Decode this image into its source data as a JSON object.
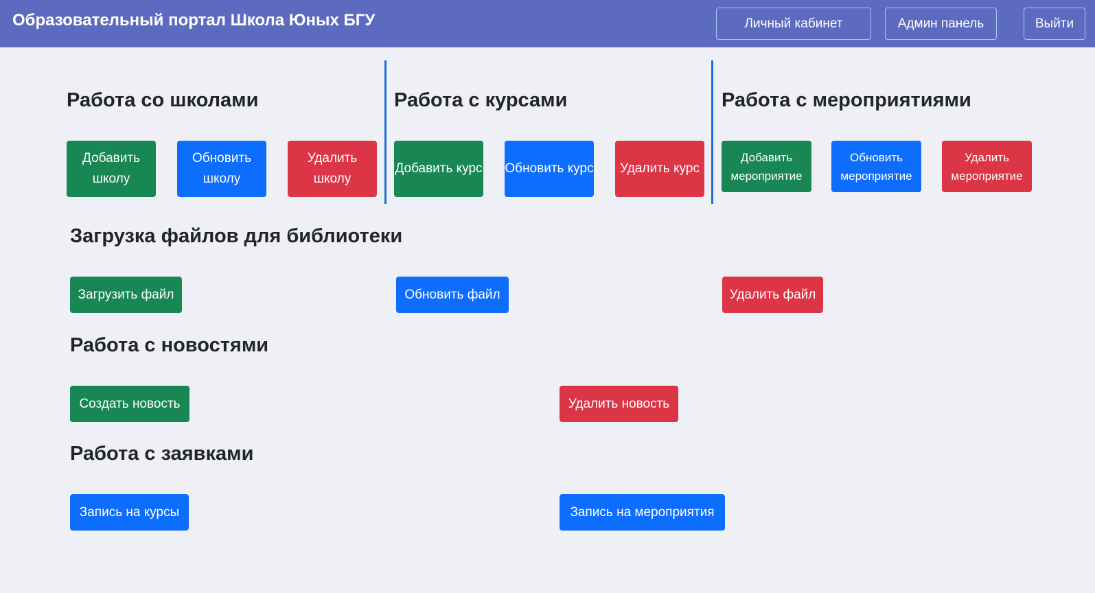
{
  "navbar": {
    "brand": "Образовательный портал Школа Юных БГУ",
    "cabinet": "Личный кабинет",
    "admin": "Админ панель",
    "logout": "Выйти"
  },
  "schools": {
    "title": "Работа со школами",
    "add": "Добавить школу",
    "update": "Обновить школу",
    "remove": "Удалить школу"
  },
  "courses": {
    "title": "Работа с курсами",
    "add": "Добавить курс",
    "update": "Обновить курс",
    "remove": "Удалить курс"
  },
  "events": {
    "title": "Работа с мероприятиями",
    "add": "Добавить мероприятие",
    "update": "Обновить мероприятие",
    "remove": "Удалить мероприятие"
  },
  "library": {
    "title": "Загрузка файлов для библиотеки",
    "upload": "Загрузить файл",
    "update": "Обновить файл",
    "remove": "Удалить файл"
  },
  "news": {
    "title": "Работа с новостями",
    "create": "Создать новость",
    "remove": "Удалить новость"
  },
  "applications": {
    "title": "Работа с заявками",
    "courses": "Запись на курсы",
    "events": "Запись на мероприятия"
  },
  "colors": {
    "navbar": "#5c6bc0",
    "background": "#eff0f5",
    "success": "#198754",
    "primary": "#0d6efd",
    "danger": "#dc3545",
    "divider": "#1c6fd6"
  }
}
